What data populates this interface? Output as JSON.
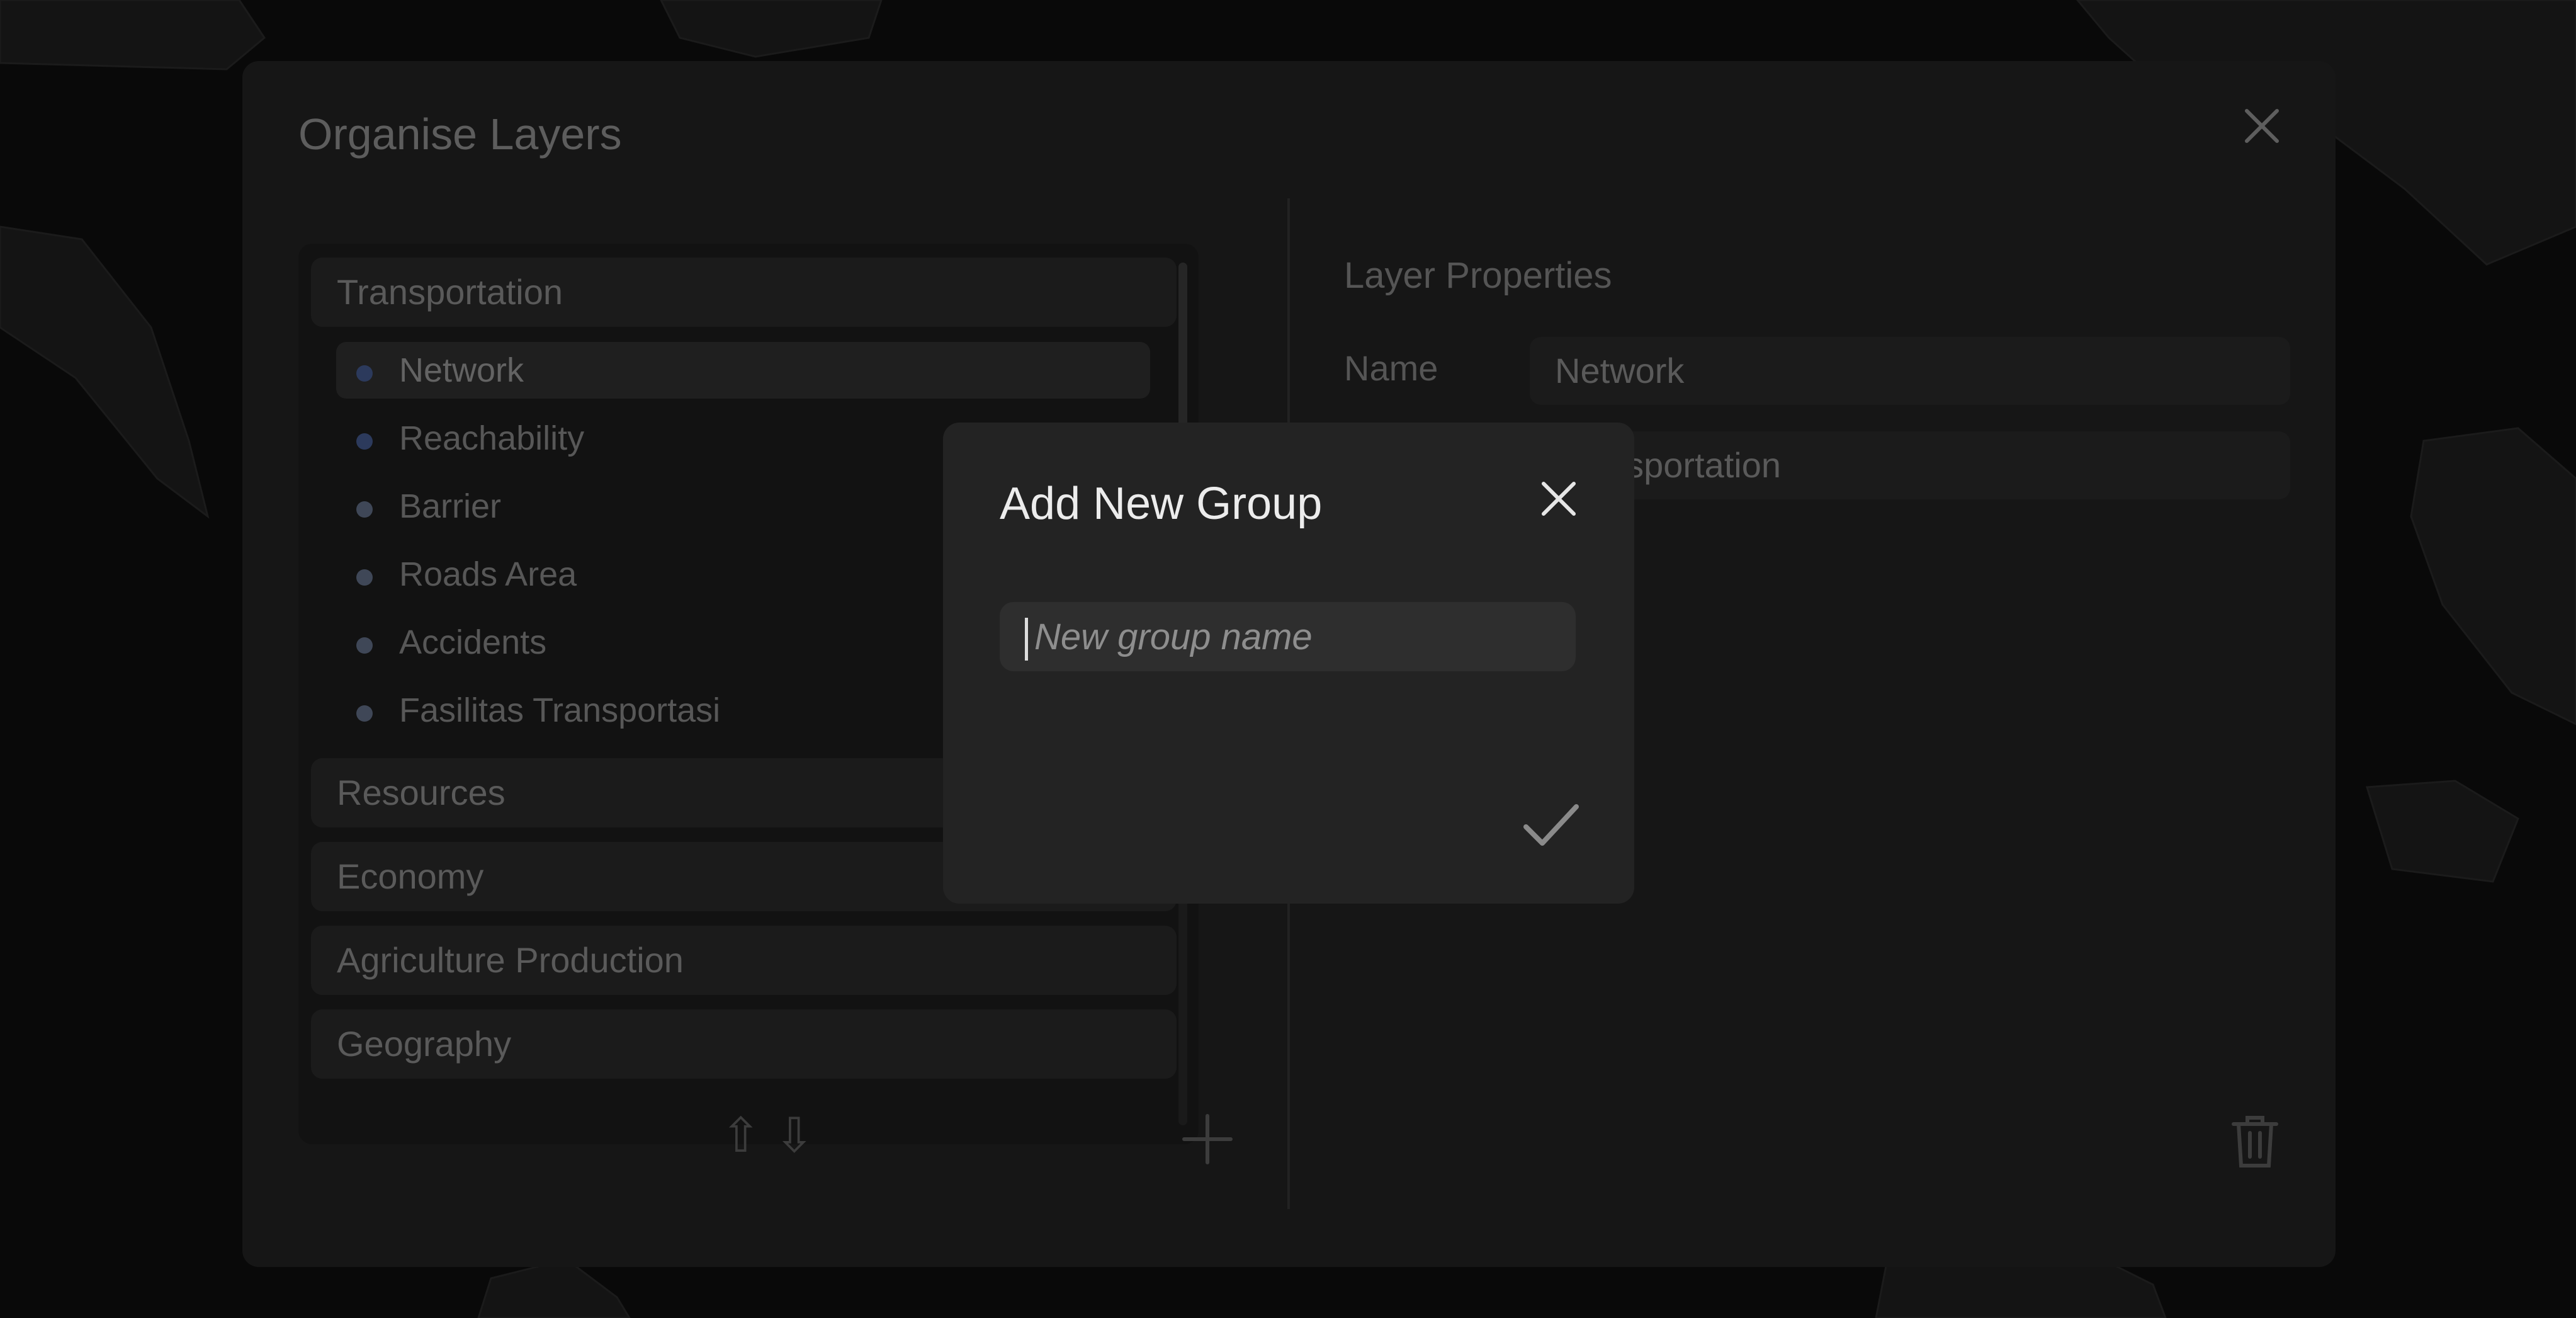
{
  "organise_dialog": {
    "title": "Organise Layers",
    "close_icon": "close-icon",
    "groups": [
      {
        "label": "Transportation",
        "expanded": true,
        "layers": [
          {
            "label": "Network",
            "selected": true,
            "dot_color": "#2c3a5c"
          },
          {
            "label": "Reachability",
            "selected": false,
            "dot_color": "#2c3a5c"
          },
          {
            "label": "Barrier",
            "selected": false,
            "dot_color": "#3f4757"
          },
          {
            "label": "Roads Area",
            "selected": false,
            "dot_color": "#3f4757"
          },
          {
            "label": "Accidents",
            "selected": false,
            "dot_color": "#3f4757"
          },
          {
            "label": "Fasilitas Transportasi",
            "selected": false,
            "dot_color": "#3f4757"
          }
        ]
      },
      {
        "label": "Resources",
        "expanded": false
      },
      {
        "label": "Economy",
        "expanded": false
      },
      {
        "label": "Agriculture Production",
        "expanded": false
      },
      {
        "label": "Geography",
        "expanded": false
      }
    ],
    "toolbar": {
      "move_up_glyph": "⇧",
      "move_down_glyph": "⇩",
      "add_icon": "plus-icon"
    },
    "layer_properties": {
      "title": "Layer Properties",
      "name_label": "Name",
      "name_value": "Network",
      "group_value": "Transportation",
      "delete_icon": "trash-icon"
    }
  },
  "add_group_modal": {
    "title": "Add New Group",
    "input_value": "",
    "input_placeholder": "New group name",
    "close_icon": "close-icon",
    "confirm_icon": "checkmark-icon"
  },
  "colors": {
    "modal_bg": "#232323",
    "dialog_bg": "#161616",
    "text_primary": "#ececec"
  }
}
